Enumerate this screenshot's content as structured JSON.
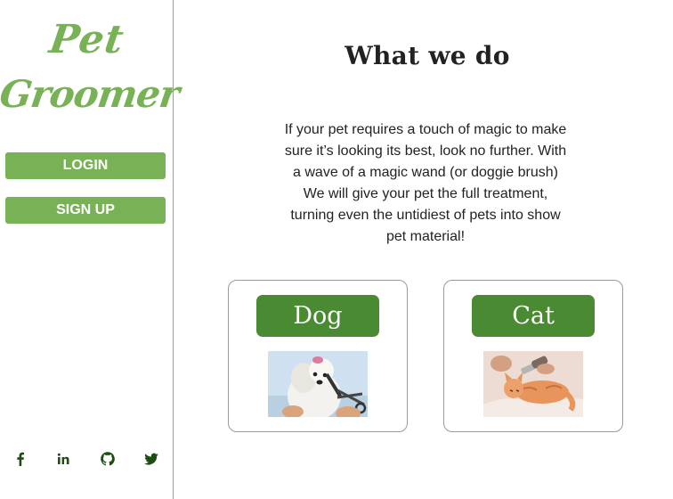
{
  "logo": {
    "line1": "Pet",
    "line2": "Groomer"
  },
  "auth": {
    "login_label": "LOGIN",
    "signup_label": "SIGN UP"
  },
  "social": {
    "icons": [
      "facebook-icon",
      "linkedin-icon",
      "github-icon",
      "twitter-icon"
    ]
  },
  "main": {
    "title": "What we do",
    "description": "If your pet requires a touch of magic to make sure it’s looking its best, look no further. With a wave of a magic wand (or doggie brush) We will give your pet the full treatment, turning even the untidiest of pets into show pet material!"
  },
  "cards": [
    {
      "label": "Dog",
      "image": "dog-grooming-photo"
    },
    {
      "label": "Cat",
      "image": "cat-grooming-photo"
    }
  ],
  "colors": {
    "brand_green": "#79b256",
    "dark_green": "#4a8a33",
    "icon_green": "#1e4d14"
  }
}
